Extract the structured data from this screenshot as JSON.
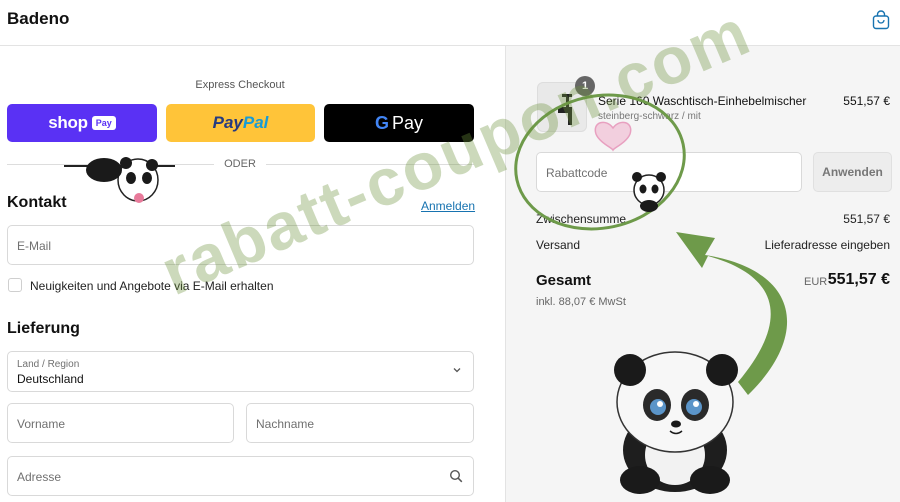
{
  "header": {
    "brand": "Badeno",
    "cart_icon": "shopping-bag-icon"
  },
  "express": {
    "title": "Express Checkout",
    "shoppay": {
      "word": "shop",
      "pill": "Pay"
    },
    "paypal": {
      "part1": "Pay",
      "part2": "Pal"
    },
    "gpay": {
      "g": "G",
      "pay": "Pay"
    },
    "divider": "ODER"
  },
  "contact": {
    "title": "Kontakt",
    "login": "Anmelden",
    "email_placeholder": "E-Mail",
    "newsletter_label": "Neuigkeiten und Angebote via E-Mail erhalten"
  },
  "delivery": {
    "title": "Lieferung",
    "country_label": "Land / Region",
    "country_value": "Deutschland",
    "firstname_placeholder": "Vorname",
    "lastname_placeholder": "Nachname",
    "address_placeholder": "Adresse"
  },
  "summary": {
    "quantity": "1",
    "product_name": "Serie 160 Waschtisch-Einhebelmischer",
    "product_variant": "steinberg-schwarz / mit",
    "product_price": "551,57 €",
    "coupon_placeholder": "Rabattcode",
    "apply_label": "Anwenden",
    "subtotal_label": "Zwischensumme",
    "subtotal_value": "551,57 €",
    "shipping_label": "Versand",
    "shipping_value": "Lieferadresse eingeben",
    "total_label": "Gesamt",
    "total_currency": "EUR",
    "total_value": "551,57 €",
    "tax_note": "inkl. 88,07 € MwSt"
  },
  "overlay": {
    "watermark": "rabatt-coupon.com"
  },
  "colors": {
    "shoppay": "#5a31f4",
    "paypal": "#ffc439",
    "gpay": "#000000",
    "link": "#1773b0",
    "arrow": "#6e9a4a"
  }
}
